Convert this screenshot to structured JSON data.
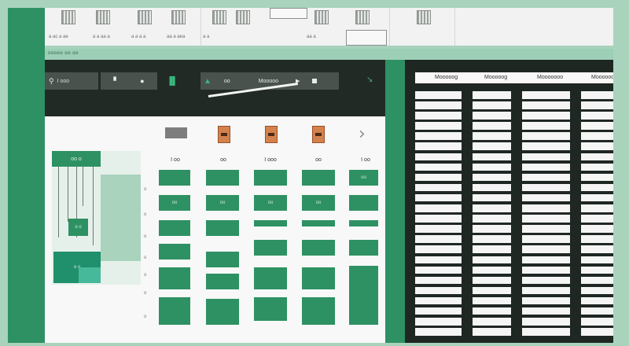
{
  "ribbon": {
    "labels": [
      "a ac a ae",
      "a a aa a",
      "a a a a",
      "aa a aea",
      "a a",
      "aa a"
    ]
  },
  "greenbar": {
    "label": "ooooo oo oo"
  },
  "toolbar": {
    "btn1": "I ooo",
    "btn2_icon": "●",
    "btn3_icon": "▐▌",
    "field_prefix": "oo",
    "field_text": "Mooooo",
    "slider_icon": "▶",
    "icon_right": "↘"
  },
  "columns": {
    "headers": [
      "I oo",
      "oo",
      "I ooo",
      "oo",
      "I oo"
    ]
  },
  "y_ticks": [
    "o",
    "o",
    "o",
    "o",
    "o",
    "o",
    "o"
  ],
  "left_panel": {
    "top_label": "oo o",
    "box_label": "o o",
    "bottom_label": "o o"
  },
  "bars": {
    "labels": [
      "oo",
      "oo",
      "oo",
      "oo",
      "oo"
    ]
  },
  "right_panel": {
    "headers": [
      "Mooooog",
      "Mooooog",
      "Mooooooo",
      "Moooooo"
    ]
  },
  "colors": {
    "accent_green": "#2e9163",
    "dark": "#222a26",
    "orange": "#d4824d"
  }
}
